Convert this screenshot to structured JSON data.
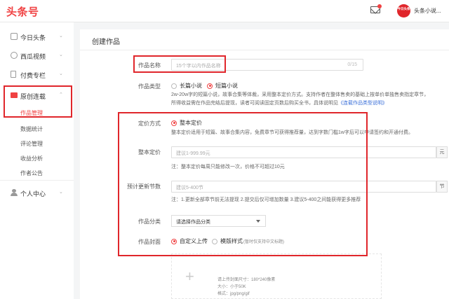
{
  "header": {
    "logo": "头条号",
    "avatar_text": "今日头条",
    "account_name": "头条小说..."
  },
  "sidebar": {
    "items": [
      {
        "label": "今日头条",
        "icon": "square-icon"
      },
      {
        "label": "西瓜视频",
        "icon": "play-circle-icon"
      },
      {
        "label": "付费专栏",
        "icon": "doc-icon"
      },
      {
        "label": "原创连载",
        "icon": "book-icon"
      },
      {
        "label": "个人中心",
        "icon": "user-icon"
      }
    ],
    "sub_items": [
      "作品管理",
      "数据统计",
      "评论管理",
      "收益分析",
      "作者公告"
    ]
  },
  "main": {
    "title": "创建作品",
    "work_name": {
      "label": "作品名称",
      "placeholder": "15个字以内作品名称",
      "count": "0/15"
    },
    "work_type": {
      "label": "作品类型",
      "options": [
        "长篇小说",
        "短篇小说"
      ],
      "selected": "短篇小说",
      "desc_line1": "2w-20w字的短篇小说，故事合集等体裁，采用整本定价方式。支持作者在整体售卖的基础上按单价单独售卖指定章节，",
      "desc_line2": "所得收益需在作品完结后提现，读者可阅读固定页数后购买全书，具体说明见",
      "link": "《连载作品类型说明》"
    },
    "pricing": {
      "label": "定价方式",
      "option": "整本定价",
      "desc": "整本定价适用于短篇、故事合集内容，免费章节可获得推荐量，达到字数门槛1w字后可以申请签约和开通付费。"
    },
    "price": {
      "label": "整本定价",
      "placeholder": "建议1-999.99元",
      "unit": "元",
      "note": "注：整本定价每周只能修改一次，价格不可超过10元"
    },
    "chapters": {
      "label": "预计更新节数",
      "placeholder": "建议5-400节",
      "unit": "节",
      "note": "注：1.更新全部章节前无法提现 2.提交后仅可增加数量 3.建议5-400之间能获得更多推荐"
    },
    "category": {
      "label": "作品分类",
      "placeholder": "请选择作品分类"
    },
    "cover": {
      "label": "作品封面",
      "options": [
        "自定义上传",
        "模版样式"
      ],
      "selected": "自定义上传",
      "template_note": "(暂时仅支持中文标题)",
      "hints": [
        "请上传封面尺寸：180*240像素",
        "大小：小于50K",
        "格式：jpg/png/gif"
      ]
    }
  },
  "colors": {
    "brand_red": "#f04142",
    "link_blue": "#3a6fd8",
    "annotation_red": "#e0262b"
  }
}
